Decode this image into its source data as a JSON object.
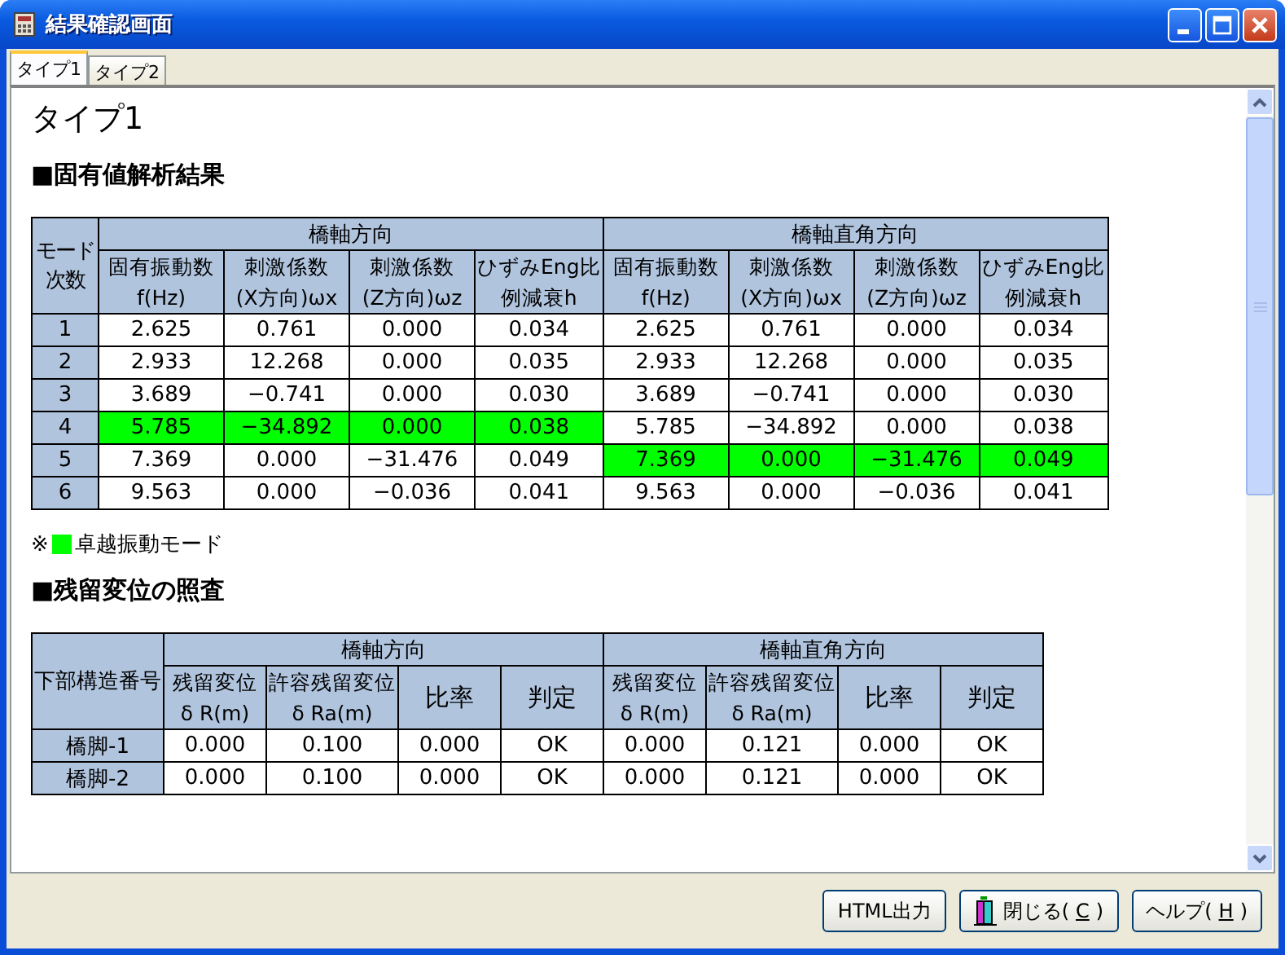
{
  "window": {
    "title": "結果確認画面"
  },
  "tabs": [
    {
      "label": "タイプ1",
      "selected": true
    },
    {
      "label": "タイプ2",
      "selected": false
    }
  ],
  "page_title": "タイプ1",
  "eigen": {
    "heading": "■固有値解析結果",
    "corner": [
      "モード",
      "次数"
    ],
    "groups": [
      {
        "label": "橋軸方向",
        "columns": [
          [
            "固有振動数",
            "f(Hz)"
          ],
          [
            "刺激係数",
            "(X方向)ωx"
          ],
          [
            "刺激係数",
            "(Z方向)ωz"
          ],
          [
            "ひずみEng比",
            "例減衰h"
          ]
        ]
      },
      {
        "label": "橋軸直角方向",
        "columns": [
          [
            "固有振動数",
            "f(Hz)"
          ],
          [
            "刺激係数",
            "(X方向)ωx"
          ],
          [
            "刺激係数",
            "(Z方向)ωz"
          ],
          [
            "ひずみEng比",
            "例減衰h"
          ]
        ]
      }
    ],
    "rows": [
      {
        "mode": "1",
        "groups": [
          {
            "values": [
              "2.625",
              "0.761",
              "0.000",
              "0.034"
            ],
            "highlighted": false
          },
          {
            "values": [
              "2.625",
              "0.761",
              "0.000",
              "0.034"
            ],
            "highlighted": false
          }
        ]
      },
      {
        "mode": "2",
        "groups": [
          {
            "values": [
              "2.933",
              "12.268",
              "0.000",
              "0.035"
            ],
            "highlighted": false
          },
          {
            "values": [
              "2.933",
              "12.268",
              "0.000",
              "0.035"
            ],
            "highlighted": false
          }
        ]
      },
      {
        "mode": "3",
        "groups": [
          {
            "values": [
              "3.689",
              "−0.741",
              "0.000",
              "0.030"
            ],
            "highlighted": false
          },
          {
            "values": [
              "3.689",
              "−0.741",
              "0.000",
              "0.030"
            ],
            "highlighted": false
          }
        ]
      },
      {
        "mode": "4",
        "groups": [
          {
            "values": [
              "5.785",
              "−34.892",
              "0.000",
              "0.038"
            ],
            "highlighted": true
          },
          {
            "values": [
              "5.785",
              "−34.892",
              "0.000",
              "0.038"
            ],
            "highlighted": false
          }
        ]
      },
      {
        "mode": "5",
        "groups": [
          {
            "values": [
              "7.369",
              "0.000",
              "−31.476",
              "0.049"
            ],
            "highlighted": false
          },
          {
            "values": [
              "7.369",
              "0.000",
              "−31.476",
              "0.049"
            ],
            "highlighted": true
          }
        ]
      },
      {
        "mode": "6",
        "groups": [
          {
            "values": [
              "9.563",
              "0.000",
              "−0.036",
              "0.041"
            ],
            "highlighted": false
          },
          {
            "values": [
              "9.563",
              "0.000",
              "−0.036",
              "0.041"
            ],
            "highlighted": false
          }
        ]
      }
    ],
    "legend": {
      "prefix": "※",
      "color": "#00ff00",
      "label": "卓越振動モード"
    }
  },
  "residual": {
    "heading": "■残留変位の照査",
    "corner": "下部構造番号",
    "groups": [
      {
        "label": "橋軸方向",
        "columns": [
          [
            "残留変位",
            "δ R(m)"
          ],
          [
            "許容残留変位",
            "δ Ra(m)"
          ],
          [
            "比率"
          ],
          [
            "判定"
          ]
        ]
      },
      {
        "label": "橋軸直角方向",
        "columns": [
          [
            "残留変位",
            "δ R(m)"
          ],
          [
            "許容残留変位",
            "δ Ra(m)"
          ],
          [
            "比率"
          ],
          [
            "判定"
          ]
        ]
      }
    ],
    "rows": [
      {
        "name": "橋脚-1",
        "groups": [
          [
            "0.000",
            "0.100",
            "0.000",
            "OK"
          ],
          [
            "0.000",
            "0.121",
            "0.000",
            "OK"
          ]
        ]
      },
      {
        "name": "橋脚-2",
        "groups": [
          [
            "0.000",
            "0.100",
            "0.000",
            "OK"
          ],
          [
            "0.000",
            "0.121",
            "0.000",
            "OK"
          ]
        ]
      }
    ]
  },
  "buttons": [
    {
      "kind": "plain",
      "label": "HTML出力"
    },
    {
      "kind": "icon",
      "label": "閉じる(",
      "mnemonic": "C",
      "suffix": ")"
    },
    {
      "kind": "plain",
      "label": "ヘルプ(",
      "mnemonic": "H",
      "suffix": ")"
    }
  ]
}
